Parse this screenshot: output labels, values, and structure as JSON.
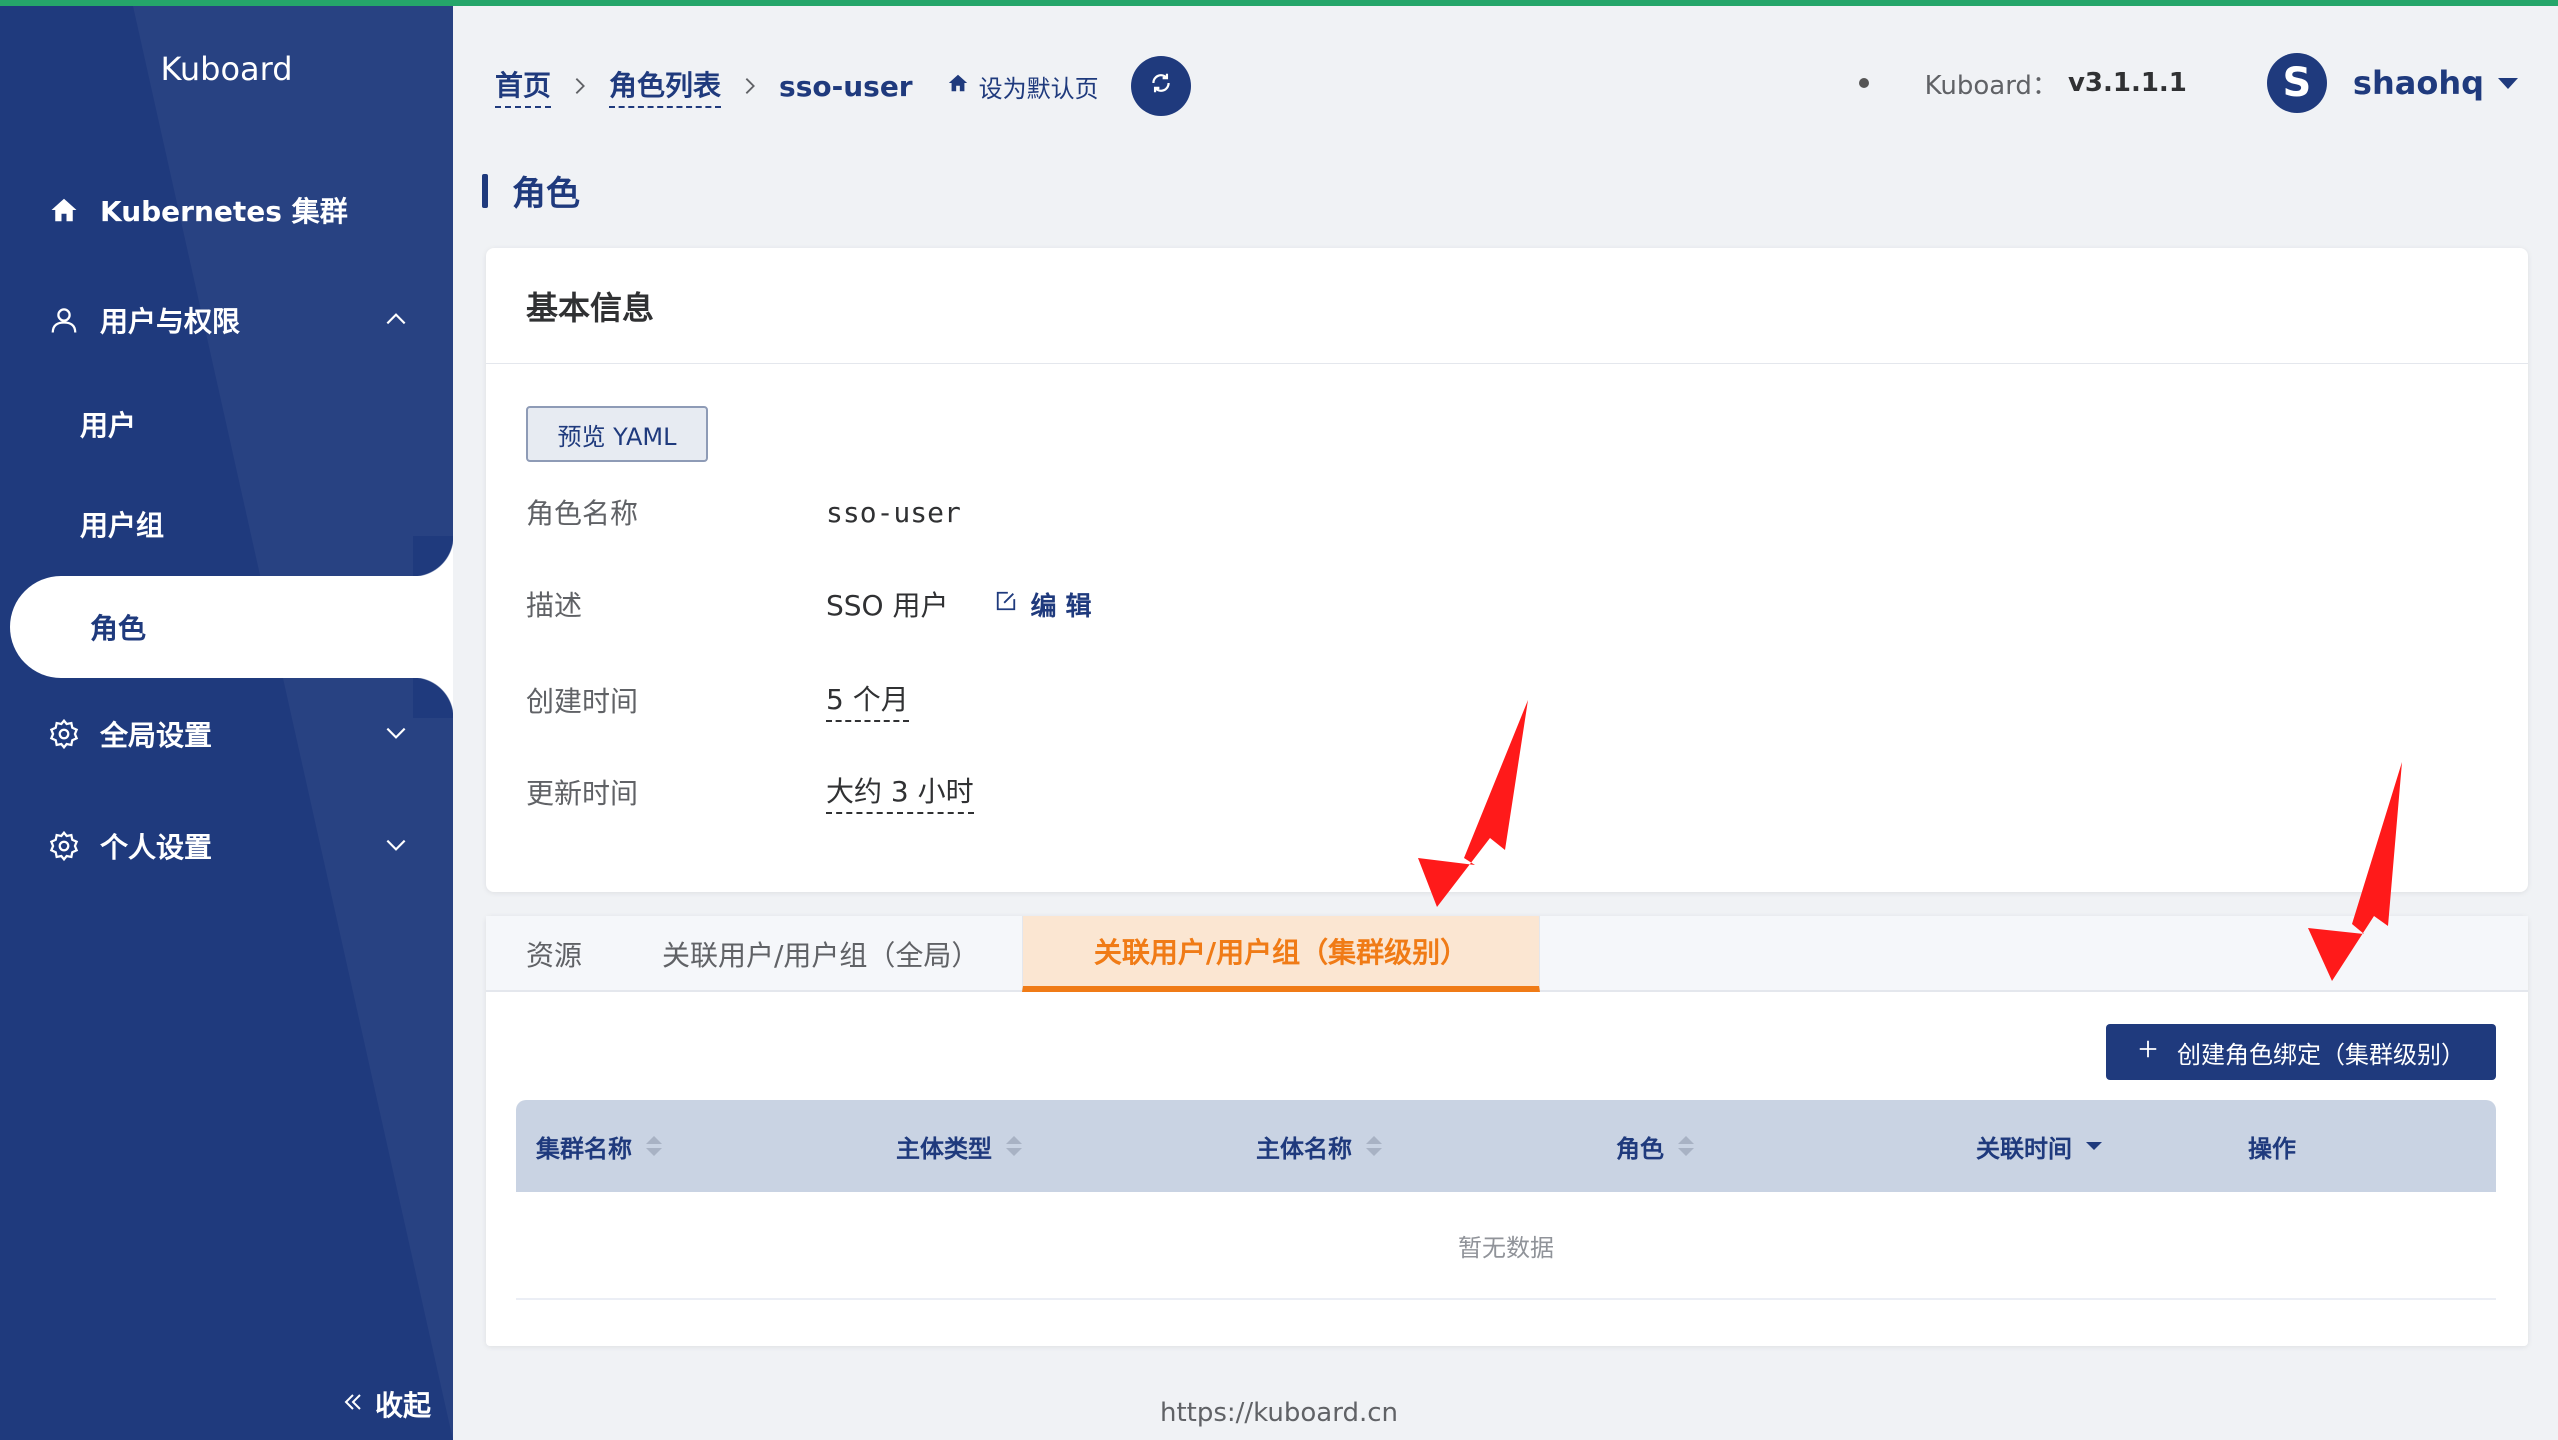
{
  "sidebar": {
    "logo": "Kuboard",
    "items": [
      {
        "label": "Kubernetes 集群",
        "icon": "home-icon"
      },
      {
        "label": "用户与权限",
        "icon": "user-icon",
        "expanded": true
      },
      {
        "label": "全局设置",
        "icon": "gear-icon",
        "expanded": false
      },
      {
        "label": "个人设置",
        "icon": "gear-icon",
        "expanded": false
      }
    ],
    "sub_items": [
      {
        "label": "用户"
      },
      {
        "label": "用户组"
      },
      {
        "label": "角色",
        "active": true
      }
    ],
    "collapse_label": "收起"
  },
  "header": {
    "breadcrumb": [
      "首页",
      "角色列表",
      "sso-user"
    ],
    "set_default": "设为默认页",
    "version_label": "Kuboard：",
    "version": "v3.1.1.1",
    "avatar_letter": "S",
    "username": "shaohq"
  },
  "page": {
    "title": "角色",
    "basic": {
      "title": "基本信息",
      "yaml_button": "预览 YAML",
      "fields": [
        {
          "label": "角色名称",
          "value": "sso-user"
        },
        {
          "label": "描述",
          "value": "SSO 用户",
          "action": "编 辑"
        },
        {
          "label": "创建时间",
          "value": "5 个月"
        },
        {
          "label": "更新时间",
          "value": "大约 3 小时"
        }
      ]
    },
    "tabs": [
      {
        "label": "资源"
      },
      {
        "label": "关联用户/用户组（全局）"
      },
      {
        "label": "关联用户/用户组（集群级别）",
        "active": true
      }
    ],
    "create_button": "创建角色绑定（集群级别）",
    "table": {
      "columns": [
        "集群名称",
        "主体类型",
        "主体名称",
        "角色",
        "关联时间",
        "操作"
      ],
      "empty_text": "暂无数据"
    }
  },
  "footer": "https://kuboard.cn",
  "colors": {
    "primary": "#1f3a7d",
    "accent": "#f07b16",
    "top_line": "#25a66a",
    "arrow": "#ff0000"
  }
}
